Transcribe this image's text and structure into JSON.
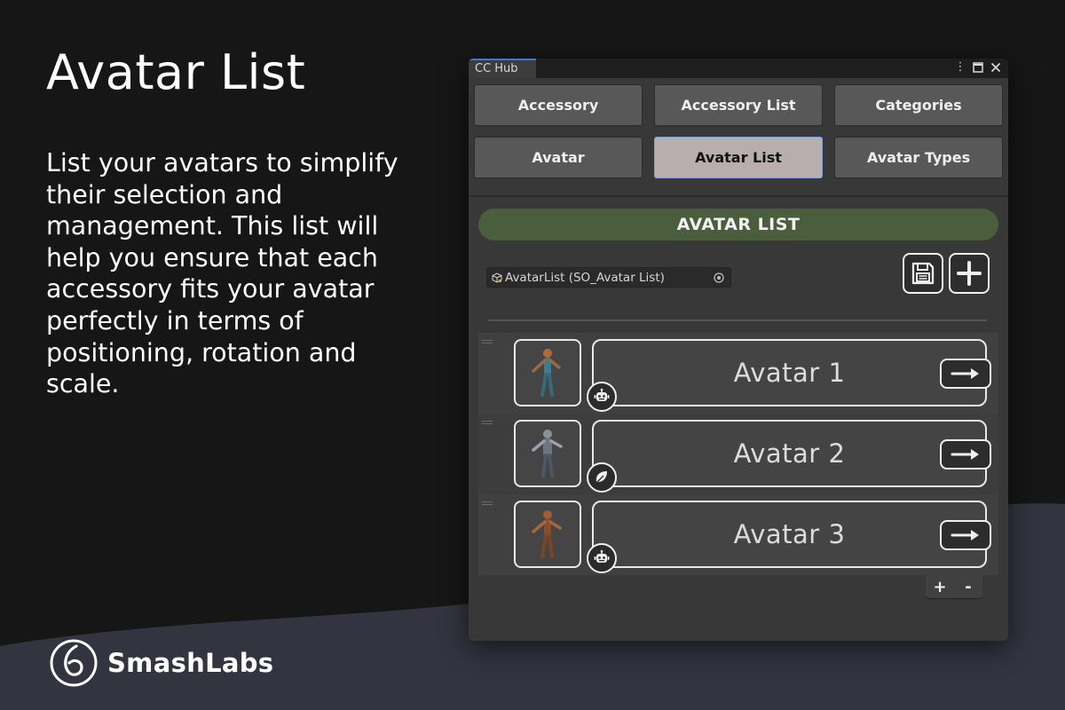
{
  "page": {
    "title": "Avatar List",
    "description": "List your avatars to simplify their selection and management. This list will help you ensure that each accessory fits your avatar perfectly in terms of positioning, rotation and scale.",
    "brand": "SmashLabs"
  },
  "window": {
    "tab_label": "CC Hub",
    "title_icons": [
      "kebab-menu-icon",
      "maximize-icon",
      "close-icon"
    ],
    "nav_buttons": [
      {
        "label": "Accessory",
        "active": false
      },
      {
        "label": "Accessory List",
        "active": false
      },
      {
        "label": "Categories",
        "active": false
      },
      {
        "label": "Avatar",
        "active": false
      },
      {
        "label": "Avatar List",
        "active": true
      },
      {
        "label": "Avatar Types",
        "active": false
      }
    ],
    "section_title": "AVATAR LIST",
    "object_field": {
      "value": "AvatarList (SO_Avatar List)",
      "icon": "scriptable-object-icon"
    },
    "action_buttons": [
      "save-icon",
      "plus-icon"
    ],
    "avatars": [
      {
        "name": "Avatar 1",
        "type_icon": "robot-icon"
      },
      {
        "name": "Avatar 2",
        "type_icon": "leaf-icon"
      },
      {
        "name": "Avatar 3",
        "type_icon": "robot-icon"
      }
    ],
    "footer": {
      "add": "+",
      "remove": "-"
    }
  },
  "colors": {
    "background": "#161616",
    "wave": "#333440",
    "window": "#383838",
    "header_green": "#4a5e3d",
    "active_button": "#b9aeae",
    "active_border": "#7fa3d8",
    "tab_accent": "#3b7bd6"
  }
}
